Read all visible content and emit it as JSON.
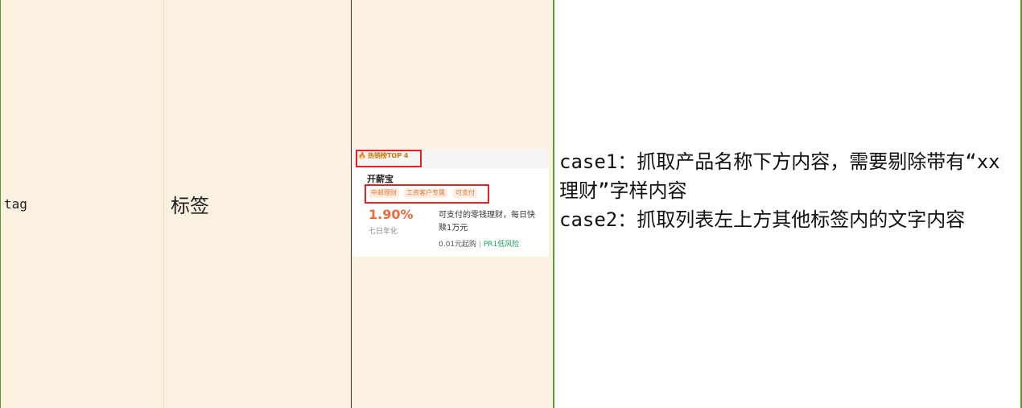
{
  "row": {
    "field": "tag",
    "label_zh": "标签",
    "description": "case1：抓取产品名称下方内容，需要剔除带有“xx理财”字样内容\ncase2：抓取列表左上方其他标签内的文字内容"
  },
  "card": {
    "hot_badge": "热销榜TOP 4",
    "product_name": "开薪宝",
    "tags": [
      "中邮理财",
      "工资客户专属",
      "可支付"
    ],
    "rate": "1.90%",
    "rate_label": "七日年化",
    "desc": "可支付的零钱理财，每日快赎1万元",
    "min_amount": "0.01元起购",
    "separator": "|",
    "risk": "PR1低风险",
    "colors": {
      "accent": "#ee6a3c",
      "risk": "#16a35c",
      "highlight": "#d9252b"
    }
  }
}
